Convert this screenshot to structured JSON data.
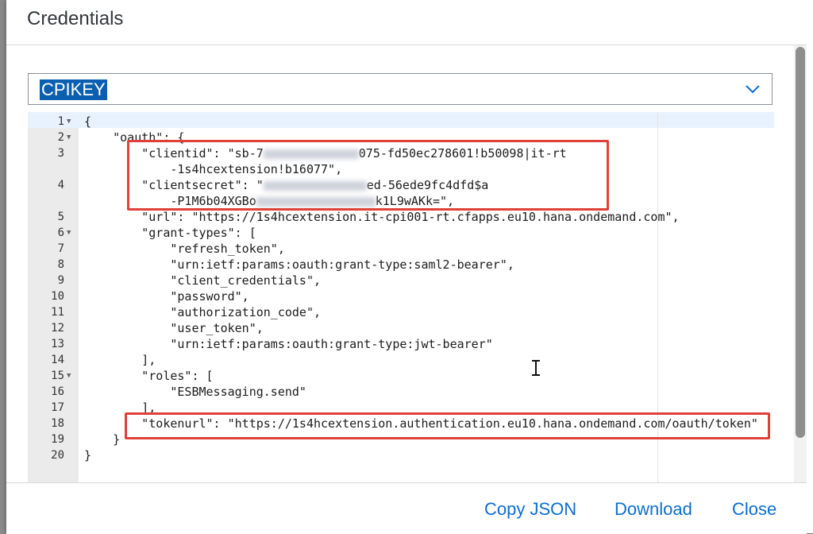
{
  "dialog": {
    "title": "Credentials",
    "selected_key": "CPIKEY"
  },
  "editor": {
    "lines": [
      {
        "n": "1",
        "fold": true,
        "text": "{"
      },
      {
        "n": "2",
        "fold": true,
        "text": "    \"oauth\": {"
      },
      {
        "n": "3",
        "fold": false,
        "text": "        \"clientid\": \"sb-7",
        "blur": 120,
        "after": "075-fd50ec278601!b50098|it-rt"
      },
      {
        "n": "",
        "fold": false,
        "text": "            -1s4hcextension!b16077\","
      },
      {
        "n": "4",
        "fold": false,
        "text": "        \"clientsecret\": \"",
        "blur": 130,
        "after": "ed-56ede9fc4dfd$a"
      },
      {
        "n": "",
        "fold": false,
        "text": "            -P1M6b04XGBo",
        "blur": 150,
        "after": "k1L9wAKk=\","
      },
      {
        "n": "5",
        "fold": false,
        "text": "        \"url\": \"https://1s4hcextension.it-cpi001-rt.cfapps.eu10.hana.ondemand.com\","
      },
      {
        "n": "6",
        "fold": true,
        "text": "        \"grant-types\": ["
      },
      {
        "n": "7",
        "fold": false,
        "text": "            \"refresh_token\","
      },
      {
        "n": "8",
        "fold": false,
        "text": "            \"urn:ietf:params:oauth:grant-type:saml2-bearer\","
      },
      {
        "n": "9",
        "fold": false,
        "text": "            \"client_credentials\","
      },
      {
        "n": "10",
        "fold": false,
        "text": "            \"password\","
      },
      {
        "n": "11",
        "fold": false,
        "text": "            \"authorization_code\","
      },
      {
        "n": "12",
        "fold": false,
        "text": "            \"user_token\","
      },
      {
        "n": "13",
        "fold": false,
        "text": "            \"urn:ietf:params:oauth:grant-type:jwt-bearer\""
      },
      {
        "n": "14",
        "fold": false,
        "text": "        ],"
      },
      {
        "n": "15",
        "fold": true,
        "text": "        \"roles\": ["
      },
      {
        "n": "16",
        "fold": false,
        "text": "            \"ESBMessaging.send\""
      },
      {
        "n": "17",
        "fold": false,
        "text": "        ],"
      },
      {
        "n": "18",
        "fold": false,
        "text": "        \"tokenurl\": \"https://1s4hcextension.authentication.eu10.hana.ondemand.com/oauth/token\""
      },
      {
        "n": "19",
        "fold": false,
        "text": "    }"
      },
      {
        "n": "20",
        "fold": false,
        "text": "}"
      }
    ]
  },
  "footer": {
    "copy_json": "Copy JSON",
    "download": "Download",
    "close": "Close"
  },
  "colors": {
    "accent": "#0a6ed1",
    "highlight_box": "#e0403a",
    "selection": "#0a5fb0"
  }
}
